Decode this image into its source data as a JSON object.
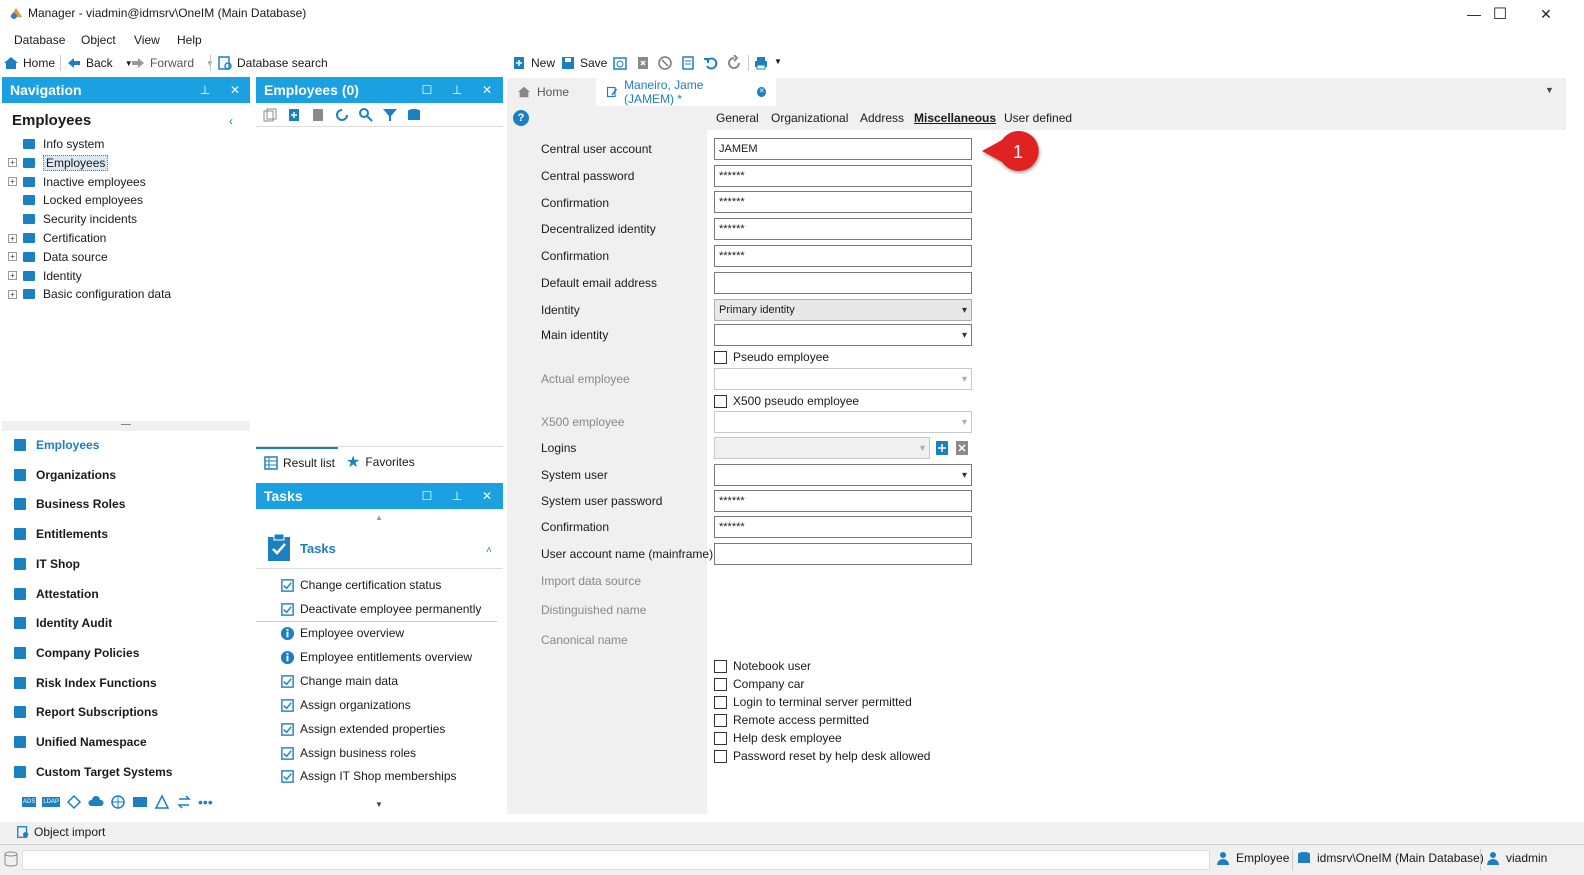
{
  "window": {
    "title": "Manager - viadmin@idmsrv\\OneIM (Main Database)",
    "minimize": "—",
    "maximize": "☐",
    "close": "✕"
  },
  "menu": [
    "Database",
    "Object",
    "View",
    "Help"
  ],
  "toolbar": {
    "home": "Home",
    "back": "Back",
    "forward": "Forward",
    "database_search": "Database search",
    "new": "New",
    "save": "Save"
  },
  "navigation": {
    "header": "Navigation",
    "section_title": "Employees",
    "tree": [
      {
        "label": "Info system",
        "expandable": false
      },
      {
        "label": "Employees",
        "expandable": true,
        "selected": true
      },
      {
        "label": "Inactive employees",
        "expandable": true
      },
      {
        "label": "Locked employees",
        "expandable": false
      },
      {
        "label": "Security incidents",
        "expandable": false
      },
      {
        "label": "Certification",
        "expandable": true
      },
      {
        "label": "Data source",
        "expandable": true
      },
      {
        "label": "Identity",
        "expandable": true
      },
      {
        "label": "Basic configuration data",
        "expandable": true
      }
    ],
    "categories": [
      {
        "label": "Employees",
        "active": true
      },
      {
        "label": "Organizations"
      },
      {
        "label": "Business Roles"
      },
      {
        "label": "Entitlements"
      },
      {
        "label": "IT Shop"
      },
      {
        "label": "Attestation"
      },
      {
        "label": "Identity Audit"
      },
      {
        "label": "Company Policies"
      },
      {
        "label": "Risk Index Functions"
      },
      {
        "label": "Report Subscriptions"
      },
      {
        "label": "Unified Namespace"
      },
      {
        "label": "Custom Target Systems"
      }
    ],
    "bottom_icons": [
      "ADS",
      "LDAP"
    ]
  },
  "result_panel": {
    "header": "Employees (0)",
    "tab_result_list": "Result list",
    "tab_favorites": "Favorites"
  },
  "tasks_panel": {
    "header": "Tasks",
    "group_title": "Tasks",
    "items": [
      "Change certification status",
      "Deactivate employee permanently",
      "Employee overview",
      "Employee entitlements overview",
      "Change main data",
      "Assign organizations",
      "Assign extended properties",
      "Assign business roles",
      "Assign IT Shop memberships"
    ]
  },
  "doc_tabs": {
    "home": "Home",
    "employee": "Maneiro, Jame (JAMEM) *"
  },
  "sub_tabs": [
    "General",
    "Organizational",
    "Address",
    "Miscellaneous",
    "User defined"
  ],
  "form": {
    "central_user_account": {
      "label": "Central user account",
      "value": "JAMEM"
    },
    "central_password": {
      "label": "Central password",
      "value": "******"
    },
    "confirmation1": {
      "label": "Confirmation",
      "value": "******"
    },
    "decentralized_identity": {
      "label": "Decentralized identity",
      "value": "******"
    },
    "confirmation2": {
      "label": "Confirmation",
      "value": "******"
    },
    "default_email": {
      "label": "Default email address",
      "value": ""
    },
    "identity": {
      "label": "Identity",
      "value": "Primary identity"
    },
    "main_identity": {
      "label": "Main identity",
      "value": ""
    },
    "pseudo_employee": "Pseudo employee",
    "actual_employee": {
      "label": "Actual employee",
      "value": ""
    },
    "x500_pseudo_employee": "X500 pseudo employee",
    "x500_employee": {
      "label": "X500 employee",
      "value": ""
    },
    "logins": {
      "label": "Logins",
      "value": ""
    },
    "system_user": {
      "label": "System user",
      "value": ""
    },
    "system_user_password": {
      "label": "System user password",
      "value": "******"
    },
    "confirmation3": {
      "label": "Confirmation",
      "value": "******"
    },
    "user_account_mainframe": {
      "label": "User account name (mainframe)",
      "value": ""
    },
    "import_data_source": "Import data source",
    "distinguished_name": "Distinguished name",
    "canonical_name": "Canonical name",
    "checkboxes": [
      "Notebook user",
      "Company car",
      "Login to terminal server permitted",
      "Remote access permitted",
      "Help desk employee",
      "Password reset by help desk allowed"
    ]
  },
  "callout": {
    "number": "1",
    "color": "#e02424"
  },
  "object_import": "Object import",
  "statusbar": {
    "employee": "Employee",
    "database": "idmsrv\\OneIM (Main Database)",
    "user": "viadmin"
  },
  "colors": {
    "accent": "#1ba1e2",
    "active_category": "#1b80c0"
  }
}
